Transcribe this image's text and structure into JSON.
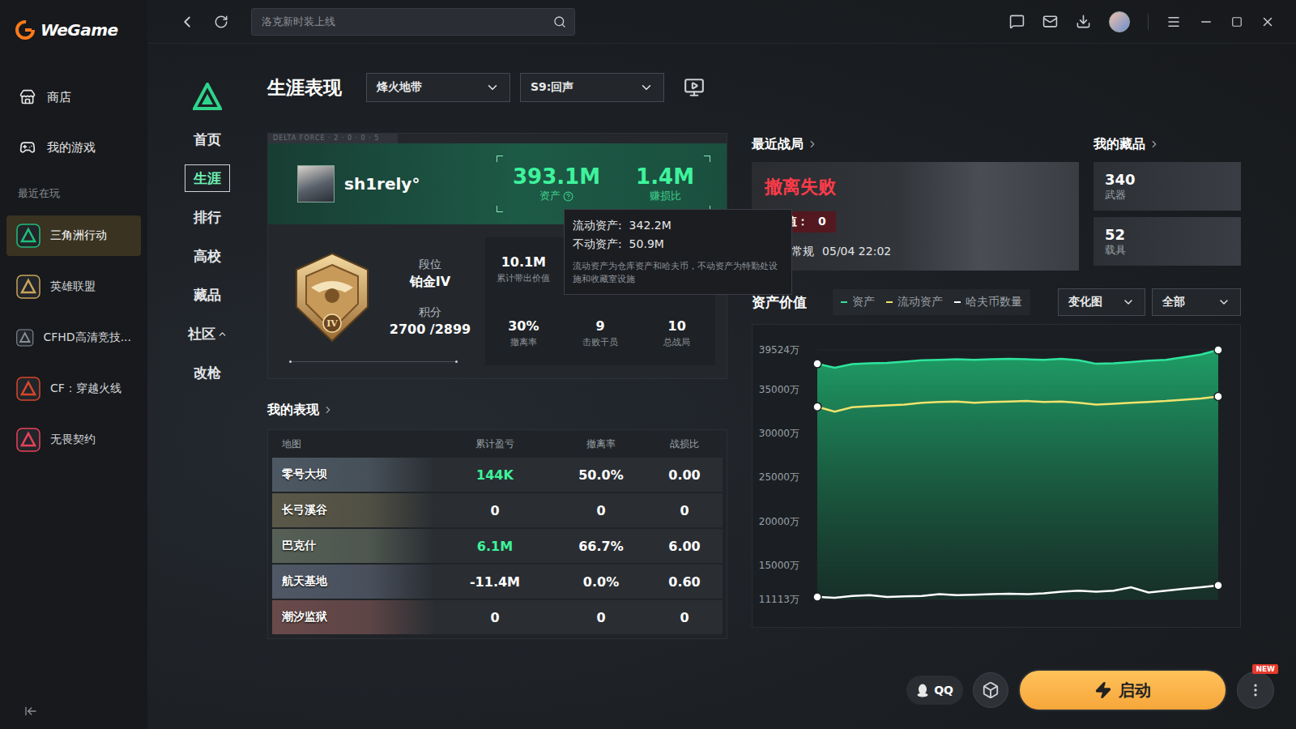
{
  "app": {
    "name": "WeGame"
  },
  "sidebar": {
    "items": [
      {
        "label": "商店",
        "selected": false
      },
      {
        "label": "我的游戏",
        "selected": false
      }
    ],
    "section": "最近在玩",
    "games": [
      {
        "label": "三角洲行动",
        "selected": true,
        "color": "#1fbf7a"
      },
      {
        "label": "英雄联盟",
        "selected": false,
        "color": "#c8a45a"
      },
      {
        "label": "CFHD高清竞技...",
        "selected": false,
        "color": "#8a9099"
      },
      {
        "label": "CF：穿越火线",
        "selected": false,
        "color": "#d9472b"
      },
      {
        "label": "无畏契约",
        "selected": false,
        "color": "#e8435a"
      }
    ]
  },
  "search": {
    "placeholder": "洛克新时装上线"
  },
  "subnav": [
    {
      "label": "首页",
      "selected": false,
      "expandable": false,
      "expanded": false
    },
    {
      "label": "生涯",
      "selected": true,
      "expandable": false,
      "expanded": false
    },
    {
      "label": "排行",
      "selected": false,
      "expandable": false,
      "expanded": false
    },
    {
      "label": "高校",
      "selected": false,
      "expandable": false,
      "expanded": false
    },
    {
      "label": "藏品",
      "selected": false,
      "expandable": false,
      "expanded": false
    },
    {
      "label": "社区",
      "selected": false,
      "expandable": true,
      "expanded": true
    },
    {
      "label": "改枪",
      "selected": false,
      "expandable": false,
      "expanded": false
    }
  ],
  "page": {
    "title": "生涯表现",
    "filters": [
      "烽火地带",
      "S9:回声"
    ]
  },
  "profile": {
    "banner": "DELTA FORCE · 2 · 0 · 0 · 5",
    "name": "sh1rely°",
    "assets": "393.1M",
    "assets_label": "资产",
    "ratio": "1.4M",
    "ratio_label": "赚损比",
    "rank_label": "段位",
    "rank": "铂金IV",
    "badge": "IV",
    "points_label": "积分",
    "points": "2700 /2899",
    "stats_top": [
      {
        "value": "10.1M",
        "label": "累计带出价值"
      }
    ],
    "stats_bottom": [
      {
        "value": "30%",
        "label": "撤离率"
      },
      {
        "value": "9",
        "label": "击败干员"
      },
      {
        "value": "10",
        "label": "总战局"
      }
    ]
  },
  "tooltip": {
    "lines": [
      "流动资产:  342.2M",
      "不动资产:  50.9M"
    ],
    "note": "流动资产为仓库资产和哈夫币，不动资产为特勤处设施和收藏室设施"
  },
  "performance": {
    "title": "我的表现",
    "columns": [
      "地图",
      "累计盈亏",
      "撤离率",
      "战损比"
    ],
    "rows": [
      {
        "map": "零号大坝",
        "profit": "144K",
        "profit_color": "#3ef39c",
        "rate": "50.0%",
        "ratio": "0.00"
      },
      {
        "map": "长弓溪谷",
        "profit": "0",
        "profit_color": "#ffffff",
        "rate": "0",
        "ratio": "0"
      },
      {
        "map": "巴克什",
        "profit": "6.1M",
        "profit_color": "#3ef39c",
        "rate": "66.7%",
        "ratio": "6.00"
      },
      {
        "map": "航天基地",
        "profit": "-11.4M",
        "profit_color": "#ffffff",
        "rate": "0.0%",
        "ratio": "0.60"
      },
      {
        "map": "潮汐监狱",
        "profit": "0",
        "profit_color": "#ffffff",
        "rate": "0",
        "ratio": "0"
      }
    ]
  },
  "recent": {
    "title": "最近战局",
    "result": "撤离失败",
    "value_label": "价值：",
    "value": "0",
    "map": "大坝-常规",
    "time": "05/04 22:02"
  },
  "collection": {
    "title": "我的藏品",
    "items": [
      {
        "count": "340",
        "label": "武器"
      },
      {
        "count": "52",
        "label": "载具"
      }
    ]
  },
  "chart": {
    "title": "资产价值",
    "view": "变化图",
    "range": "全部",
    "ticks": [
      "39524万",
      "35000万",
      "30000万",
      "25000万",
      "20000万",
      "15000万",
      "11113万"
    ],
    "series": [
      {
        "label": "资产",
        "color": "#2ee59d",
        "values": [
          37950,
          37500,
          37900,
          38000,
          38050,
          38200,
          38350,
          38400,
          38450,
          38400,
          38450,
          38500,
          38450,
          38400,
          38500,
          38350,
          37950,
          38000,
          38150,
          38300,
          38400,
          38700,
          39000,
          39524
        ]
      },
      {
        "label": "流动资产",
        "color": "#f1e36c",
        "values": [
          33050,
          32500,
          33000,
          33100,
          33200,
          33300,
          33500,
          33600,
          33650,
          33500,
          33600,
          33650,
          33700,
          33600,
          33650,
          33500,
          33300,
          33400,
          33500,
          33600,
          33700,
          33850,
          34000,
          34220
        ]
      },
      {
        "label": "哈夫币数量",
        "color": "#ffffff",
        "values": [
          11400,
          11300,
          11500,
          11600,
          11400,
          11450,
          11500,
          11700,
          11600,
          11650,
          11700,
          11750,
          11700,
          11800,
          12000,
          12100,
          12000,
          12100,
          12500,
          11900,
          12100,
          12300,
          12500,
          12700
        ]
      }
    ]
  },
  "footer": {
    "qq": "QQ",
    "launch": "启动",
    "badge": "NEW"
  }
}
